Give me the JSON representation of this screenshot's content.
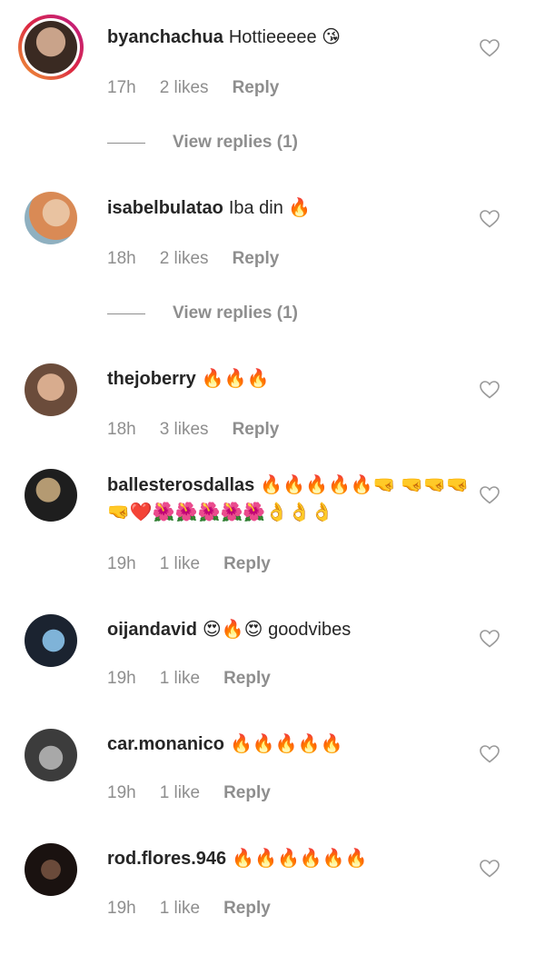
{
  "comments": [
    {
      "username": "byanchachua",
      "text": "Hottieeeee 😘",
      "time": "17h",
      "likes": "2 likes",
      "reply_label": "Reply",
      "view_replies": "View replies (1)",
      "avatar_colors": [
        "#3a2a22",
        "#c9a38a"
      ],
      "story_ring": true
    },
    {
      "username": "isabelbulatao",
      "text": "Iba din 🔥",
      "time": "18h",
      "likes": "2 likes",
      "reply_label": "Reply",
      "view_replies": "View replies (1)",
      "avatar_colors": [
        "#d98a55",
        "#e9c3a1"
      ]
    },
    {
      "username": "thejoberry",
      "text": "🔥🔥🔥",
      "time": "18h",
      "likes": "3 likes",
      "reply_label": "Reply",
      "avatar_colors": [
        "#6b4c3b",
        "#d8ac8e"
      ]
    },
    {
      "username": "ballesterosdallas",
      "text": "🔥🔥🔥🔥🔥🤜 🤜🤜🤜🤜❤️🌺🌺🌺🌺🌺👌👌👌",
      "time": "19h",
      "likes": "1 like",
      "reply_label": "Reply",
      "avatar_colors": [
        "#1e1e1e",
        "#b49a72"
      ]
    },
    {
      "username": "oijandavid",
      "text": "😍🔥😍 goodvibes",
      "time": "19h",
      "likes": "1 like",
      "reply_label": "Reply",
      "avatar_colors": [
        "#1b2330",
        "#7fb3d8"
      ]
    },
    {
      "username": "car.monanico",
      "text": "🔥🔥🔥🔥🔥",
      "time": "19h",
      "likes": "1 like",
      "reply_label": "Reply",
      "avatar_colors": [
        "#3c3c3c",
        "#a8a8a8"
      ]
    },
    {
      "username": "rod.flores.946",
      "text": "🔥🔥🔥🔥🔥🔥",
      "time": "19h",
      "likes": "1 like",
      "reply_label": "Reply",
      "avatar_colors": [
        "#1a1210",
        "#6a4a3a"
      ]
    }
  ],
  "icons": {
    "like": "heart-outline-icon"
  },
  "colors": {
    "text": "#262626",
    "secondary": "#8e8e8e"
  }
}
